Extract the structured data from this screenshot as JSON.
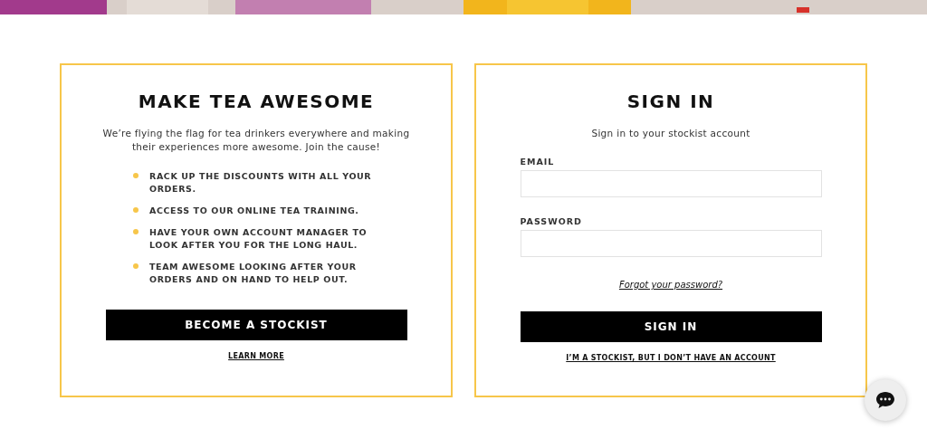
{
  "stockist_card": {
    "title": "MAKE TEA AWESOME",
    "intro": "We’re flying the flag for tea drinkers everywhere and making their experiences more awesome. Join the cause!",
    "benefits": [
      "RACK UP THE DISCOUNTS WITH ALL YOUR ORDERS.",
      "ACCESS TO OUR ONLINE TEA TRAINING.",
      "HAVE YOUR OWN ACCOUNT MANAGER TO LOOK AFTER YOU FOR THE LONG HAUL.",
      "TEAM AWESOME LOOKING AFTER YOUR ORDERS AND ON HAND TO HELP OUT."
    ],
    "button": "BECOME A STOCKIST",
    "link": "LEARN MORE"
  },
  "signin_card": {
    "title": "SIGN IN",
    "subtitle": "Sign in to your stockist account",
    "fields": [
      {
        "label": "EMAIL"
      },
      {
        "label": "PASSWORD"
      }
    ],
    "forgot_link": "Forgot your password?",
    "button": "SIGN IN",
    "link": "I’M A STOCKIST, BUT I DON’T HAVE AN ACCOUNT"
  }
}
